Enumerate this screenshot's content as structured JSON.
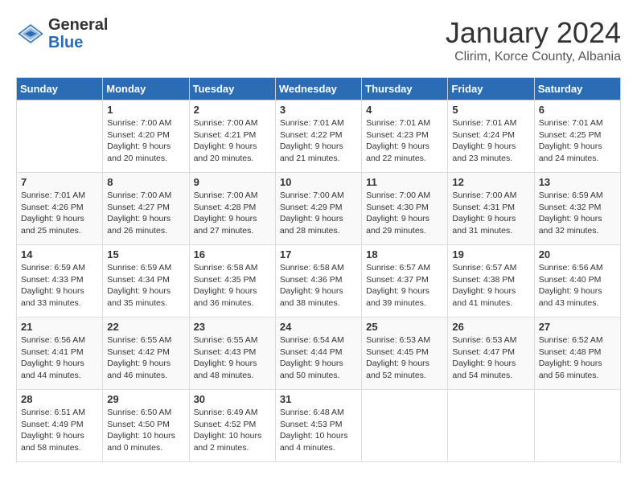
{
  "logo": {
    "general": "General",
    "blue": "Blue"
  },
  "title": {
    "month_year": "January 2024",
    "location": "Clirim, Korce County, Albania"
  },
  "headers": [
    "Sunday",
    "Monday",
    "Tuesday",
    "Wednesday",
    "Thursday",
    "Friday",
    "Saturday"
  ],
  "weeks": [
    [
      {
        "day": "",
        "sunrise": "",
        "sunset": "",
        "daylight": ""
      },
      {
        "day": "1",
        "sunrise": "Sunrise: 7:00 AM",
        "sunset": "Sunset: 4:20 PM",
        "daylight": "Daylight: 9 hours and 20 minutes."
      },
      {
        "day": "2",
        "sunrise": "Sunrise: 7:00 AM",
        "sunset": "Sunset: 4:21 PM",
        "daylight": "Daylight: 9 hours and 20 minutes."
      },
      {
        "day": "3",
        "sunrise": "Sunrise: 7:01 AM",
        "sunset": "Sunset: 4:22 PM",
        "daylight": "Daylight: 9 hours and 21 minutes."
      },
      {
        "day": "4",
        "sunrise": "Sunrise: 7:01 AM",
        "sunset": "Sunset: 4:23 PM",
        "daylight": "Daylight: 9 hours and 22 minutes."
      },
      {
        "day": "5",
        "sunrise": "Sunrise: 7:01 AM",
        "sunset": "Sunset: 4:24 PM",
        "daylight": "Daylight: 9 hours and 23 minutes."
      },
      {
        "day": "6",
        "sunrise": "Sunrise: 7:01 AM",
        "sunset": "Sunset: 4:25 PM",
        "daylight": "Daylight: 9 hours and 24 minutes."
      }
    ],
    [
      {
        "day": "7",
        "sunrise": "Sunrise: 7:01 AM",
        "sunset": "Sunset: 4:26 PM",
        "daylight": "Daylight: 9 hours and 25 minutes."
      },
      {
        "day": "8",
        "sunrise": "Sunrise: 7:00 AM",
        "sunset": "Sunset: 4:27 PM",
        "daylight": "Daylight: 9 hours and 26 minutes."
      },
      {
        "day": "9",
        "sunrise": "Sunrise: 7:00 AM",
        "sunset": "Sunset: 4:28 PM",
        "daylight": "Daylight: 9 hours and 27 minutes."
      },
      {
        "day": "10",
        "sunrise": "Sunrise: 7:00 AM",
        "sunset": "Sunset: 4:29 PM",
        "daylight": "Daylight: 9 hours and 28 minutes."
      },
      {
        "day": "11",
        "sunrise": "Sunrise: 7:00 AM",
        "sunset": "Sunset: 4:30 PM",
        "daylight": "Daylight: 9 hours and 29 minutes."
      },
      {
        "day": "12",
        "sunrise": "Sunrise: 7:00 AM",
        "sunset": "Sunset: 4:31 PM",
        "daylight": "Daylight: 9 hours and 31 minutes."
      },
      {
        "day": "13",
        "sunrise": "Sunrise: 6:59 AM",
        "sunset": "Sunset: 4:32 PM",
        "daylight": "Daylight: 9 hours and 32 minutes."
      }
    ],
    [
      {
        "day": "14",
        "sunrise": "Sunrise: 6:59 AM",
        "sunset": "Sunset: 4:33 PM",
        "daylight": "Daylight: 9 hours and 33 minutes."
      },
      {
        "day": "15",
        "sunrise": "Sunrise: 6:59 AM",
        "sunset": "Sunset: 4:34 PM",
        "daylight": "Daylight: 9 hours and 35 minutes."
      },
      {
        "day": "16",
        "sunrise": "Sunrise: 6:58 AM",
        "sunset": "Sunset: 4:35 PM",
        "daylight": "Daylight: 9 hours and 36 minutes."
      },
      {
        "day": "17",
        "sunrise": "Sunrise: 6:58 AM",
        "sunset": "Sunset: 4:36 PM",
        "daylight": "Daylight: 9 hours and 38 minutes."
      },
      {
        "day": "18",
        "sunrise": "Sunrise: 6:57 AM",
        "sunset": "Sunset: 4:37 PM",
        "daylight": "Daylight: 9 hours and 39 minutes."
      },
      {
        "day": "19",
        "sunrise": "Sunrise: 6:57 AM",
        "sunset": "Sunset: 4:38 PM",
        "daylight": "Daylight: 9 hours and 41 minutes."
      },
      {
        "day": "20",
        "sunrise": "Sunrise: 6:56 AM",
        "sunset": "Sunset: 4:40 PM",
        "daylight": "Daylight: 9 hours and 43 minutes."
      }
    ],
    [
      {
        "day": "21",
        "sunrise": "Sunrise: 6:56 AM",
        "sunset": "Sunset: 4:41 PM",
        "daylight": "Daylight: 9 hours and 44 minutes."
      },
      {
        "day": "22",
        "sunrise": "Sunrise: 6:55 AM",
        "sunset": "Sunset: 4:42 PM",
        "daylight": "Daylight: 9 hours and 46 minutes."
      },
      {
        "day": "23",
        "sunrise": "Sunrise: 6:55 AM",
        "sunset": "Sunset: 4:43 PM",
        "daylight": "Daylight: 9 hours and 48 minutes."
      },
      {
        "day": "24",
        "sunrise": "Sunrise: 6:54 AM",
        "sunset": "Sunset: 4:44 PM",
        "daylight": "Daylight: 9 hours and 50 minutes."
      },
      {
        "day": "25",
        "sunrise": "Sunrise: 6:53 AM",
        "sunset": "Sunset: 4:45 PM",
        "daylight": "Daylight: 9 hours and 52 minutes."
      },
      {
        "day": "26",
        "sunrise": "Sunrise: 6:53 AM",
        "sunset": "Sunset: 4:47 PM",
        "daylight": "Daylight: 9 hours and 54 minutes."
      },
      {
        "day": "27",
        "sunrise": "Sunrise: 6:52 AM",
        "sunset": "Sunset: 4:48 PM",
        "daylight": "Daylight: 9 hours and 56 minutes."
      }
    ],
    [
      {
        "day": "28",
        "sunrise": "Sunrise: 6:51 AM",
        "sunset": "Sunset: 4:49 PM",
        "daylight": "Daylight: 9 hours and 58 minutes."
      },
      {
        "day": "29",
        "sunrise": "Sunrise: 6:50 AM",
        "sunset": "Sunset: 4:50 PM",
        "daylight": "Daylight: 10 hours and 0 minutes."
      },
      {
        "day": "30",
        "sunrise": "Sunrise: 6:49 AM",
        "sunset": "Sunset: 4:52 PM",
        "daylight": "Daylight: 10 hours and 2 minutes."
      },
      {
        "day": "31",
        "sunrise": "Sunrise: 6:48 AM",
        "sunset": "Sunset: 4:53 PM",
        "daylight": "Daylight: 10 hours and 4 minutes."
      },
      {
        "day": "",
        "sunrise": "",
        "sunset": "",
        "daylight": ""
      },
      {
        "day": "",
        "sunrise": "",
        "sunset": "",
        "daylight": ""
      },
      {
        "day": "",
        "sunrise": "",
        "sunset": "",
        "daylight": ""
      }
    ]
  ]
}
